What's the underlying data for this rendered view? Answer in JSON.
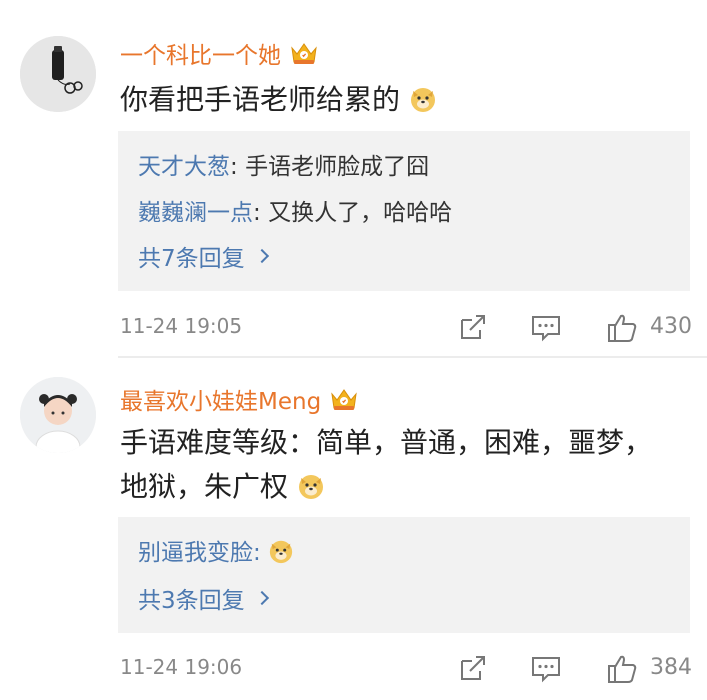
{
  "comments": [
    {
      "username": "一个科比一个她",
      "text": "你看把手语老师给累的",
      "replies": [
        {
          "name": "天才大葱",
          "sep": ": ",
          "text": "手语老师脸成了囧"
        },
        {
          "name": "巍巍澜一点",
          "sep": ": ",
          "text": "又换人了，哈哈哈"
        }
      ],
      "more_replies": "共7条回复",
      "time": "11-24 19:05",
      "likes": "430"
    },
    {
      "username": "最喜欢小娃娃Meng",
      "text_line1": "手语难度等级：简单，普通，困难，噩梦，",
      "text_line2": "地狱，朱广权",
      "replies": [
        {
          "name": "别逼我变脸:",
          "text": ""
        }
      ],
      "more_replies": "共3条回复",
      "time": "11-24 19:06",
      "likes": "384"
    }
  ],
  "colors": {
    "username": "#e8762c",
    "link": "#4d79b0",
    "reply_bg": "#f2f2f2",
    "meta": "#888888"
  },
  "icons": [
    "crown-vip-icon",
    "doge-emoji-icon",
    "share-icon",
    "comment-icon",
    "like-icon",
    "chevron-right-icon"
  ]
}
